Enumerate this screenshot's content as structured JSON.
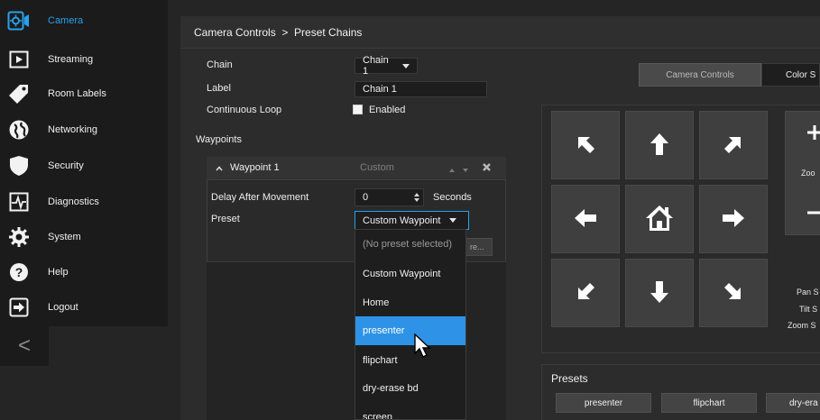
{
  "sidebar": {
    "items": [
      {
        "label": "Camera",
        "icon": "camera-icon"
      },
      {
        "label": "Streaming",
        "icon": "play-icon"
      },
      {
        "label": "Room Labels",
        "icon": "tag-icon"
      },
      {
        "label": "Networking",
        "icon": "globe-icon"
      },
      {
        "label": "Security",
        "icon": "shield-icon"
      },
      {
        "label": "Diagnostics",
        "icon": "pulse-icon"
      },
      {
        "label": "System",
        "icon": "gear-icon"
      },
      {
        "label": "Help",
        "icon": "help-icon"
      },
      {
        "label": "Logout",
        "icon": "logout-icon"
      }
    ],
    "collapse_glyph": "<"
  },
  "breadcrumb": "Camera Controls  >  Preset Chains",
  "chain_form": {
    "chain_label": "Chain",
    "chain_value": "Chain 1",
    "label_label": "Label",
    "label_value": "Chain 1",
    "loop_label": "Continuous Loop",
    "loop_option": "Enabled",
    "loop_checked": false
  },
  "waypoints": {
    "heading": "Waypoints",
    "item": {
      "toggle_glyph": "^",
      "title": "Waypoint 1",
      "type": "Custom",
      "delay_label": "Delay After Movement",
      "delay_value": "0",
      "delay_unit": "Seconds",
      "preset_label": "Preset",
      "preset_value": "Custom Waypoint",
      "hidden_button_fragment": "re..."
    }
  },
  "preset_dropdown": {
    "options": [
      "(No preset selected)",
      "Custom Waypoint",
      "Home",
      "presenter",
      "flipchart",
      "dry-erase bd",
      "screen"
    ],
    "highlighted": "presenter"
  },
  "camera_tabs": [
    "Camera Controls",
    "Color S"
  ],
  "zoom_label": "Zoo",
  "speed_labels": [
    "Pan S",
    "Tilt S",
    "Zoom S"
  ],
  "presets": {
    "heading": "Presets",
    "buttons": [
      "presenter",
      "flipchart",
      "dry-era"
    ]
  },
  "colors": {
    "accent": "#2aa0ea",
    "highlight": "#2e93e6"
  }
}
